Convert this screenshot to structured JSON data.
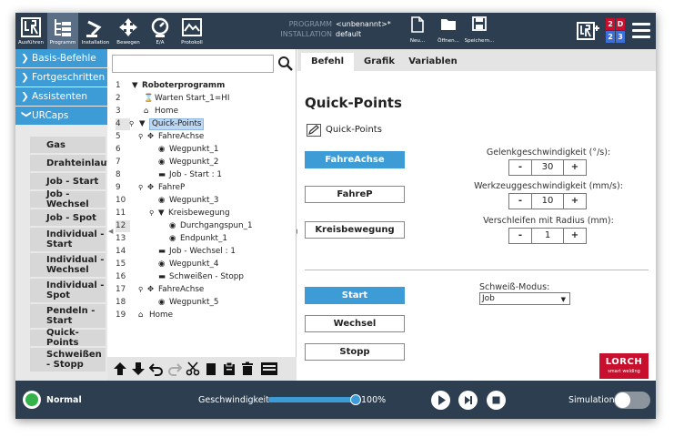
{
  "topbar": {
    "buttons": [
      {
        "id": "run",
        "label": "Ausführen"
      },
      {
        "id": "program",
        "label": "Programm"
      },
      {
        "id": "installation",
        "label": "Installation"
      },
      {
        "id": "move",
        "label": "Bewegen"
      },
      {
        "id": "io",
        "label": "E/A"
      },
      {
        "id": "log",
        "label": "Protokoll"
      }
    ],
    "program_key": "PROGRAMM",
    "program_value": "<unbenannt>*",
    "installation_key": "INSTALLATION",
    "installation_value": "default",
    "file_buttons": [
      {
        "id": "new",
        "label": "Neu..."
      },
      {
        "id": "open",
        "label": "Öffnen..."
      },
      {
        "id": "save",
        "label": "Speichern..."
      }
    ],
    "lang_cells": [
      "2",
      "D",
      "2",
      "3"
    ]
  },
  "nav": {
    "categories": [
      "Basis-Befehle",
      "Fortgeschritten",
      "Assistenten",
      "URCaps"
    ],
    "items": [
      "Gas",
      "Drahteinlauf",
      "Job - Start",
      "Job - Wechsel",
      "Job - Spot",
      "Individual - Start",
      "Individual - Wechsel",
      "Individual - Spot",
      "Pendeln - Start",
      "Quick-Points",
      "Schweißen - Stopp"
    ]
  },
  "tree": {
    "rows": [
      {
        "n": "1",
        "text": "Roboterprogramm"
      },
      {
        "n": "2",
        "text": "Warten Start_1=HI"
      },
      {
        "n": "3",
        "text": "Home"
      },
      {
        "n": "4",
        "text": "Quick-Points"
      },
      {
        "n": "5",
        "text": "FahreAchse"
      },
      {
        "n": "6",
        "text": "Wegpunkt_1"
      },
      {
        "n": "7",
        "text": "Wegpunkt_2"
      },
      {
        "n": "8",
        "text": "Job - Start : 1"
      },
      {
        "n": "9",
        "text": "FahreP"
      },
      {
        "n": "10",
        "text": "Wegpunkt_3"
      },
      {
        "n": "11",
        "text": "Kreisbewegung"
      },
      {
        "n": "12",
        "text": "Durchgangspun_1"
      },
      {
        "n": "13",
        "text": "Endpunkt_1"
      },
      {
        "n": "14",
        "text": "Job - Wechsel : 1"
      },
      {
        "n": "15",
        "text": "Wegpunkt_4"
      },
      {
        "n": "16",
        "text": "Schweißen - Stopp"
      },
      {
        "n": "17",
        "text": "FahreAchse"
      },
      {
        "n": "18",
        "text": "Wegpunkt_5"
      },
      {
        "n": "19",
        "text": "Home"
      }
    ]
  },
  "tabs": [
    "Befehl",
    "Grafik",
    "Variablen"
  ],
  "panel": {
    "title": "Quick-Points",
    "node_name": "Quick-Points",
    "move_buttons": [
      "FahreAchse",
      "FahreP",
      "Kreisbewegung"
    ],
    "action_buttons": [
      "Start",
      "Wechsel",
      "Stopp"
    ],
    "joint_speed_label": "Gelenkgeschwindigkeit (°/s):",
    "joint_speed_value": "30",
    "tool_speed_label": "Werkzeuggeschwindigkeit (mm/s):",
    "tool_speed_value": "10",
    "blend_label": "Verschleifen mit Radius (mm):",
    "blend_value": "1",
    "minus": "-",
    "plus": "+",
    "weld_mode_label": "Schweiß-Modus:",
    "weld_mode_value": "Job",
    "logo_name": "LORCH",
    "logo_tagline": "smart welding"
  },
  "bottombar": {
    "status": "Normal",
    "speed_label": "Geschwindigkeit",
    "speed_value": "100%",
    "speed_fraction": 1.0,
    "simulation_label": "Simulation"
  },
  "colors": {
    "bar": "#2c3e50",
    "accent": "#3d9bd6",
    "selection": "#bcd7ef",
    "status_green": "#36b24a",
    "logo_red": "#c8102e"
  }
}
